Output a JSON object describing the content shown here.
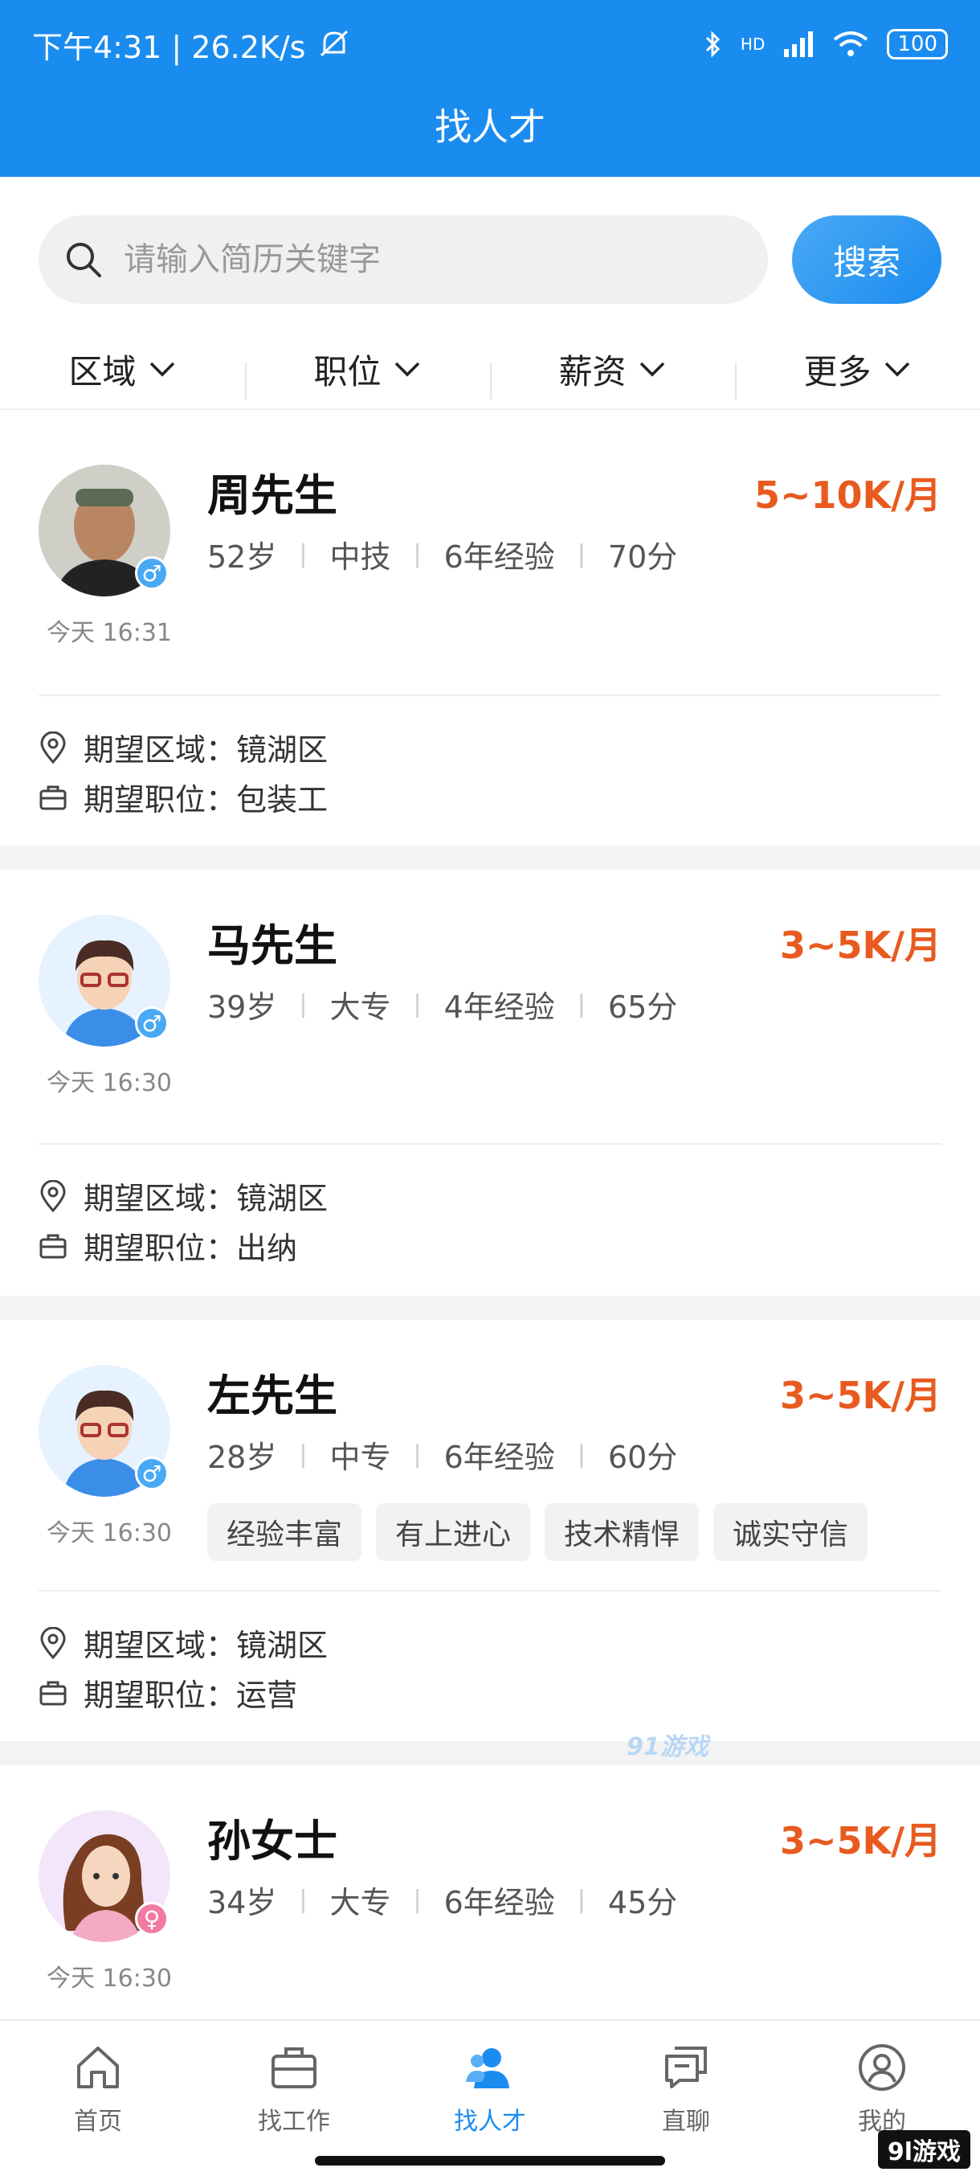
{
  "status_bar": {
    "time_and_speed": "下午4:31 | 26.2K/s",
    "signal": "HD",
    "battery": "100"
  },
  "header": {
    "title": "找人才"
  },
  "search": {
    "placeholder": "请输入简历关键字",
    "value": "",
    "button_label": "搜索"
  },
  "filters": [
    {
      "label": "区域"
    },
    {
      "label": "职位"
    },
    {
      "label": "薪资"
    },
    {
      "label": "更多"
    }
  ],
  "expect_labels": {
    "area": "期望区域：",
    "position": "期望职位："
  },
  "candidates": [
    {
      "name": "周先生",
      "salary": "5~10K/月",
      "age": "52岁",
      "education": "中技",
      "experience": "6年经验",
      "score": "70分",
      "time": "今天 16:31",
      "gender_symbol": "♂",
      "area": "镜湖区",
      "position": "包装工",
      "tags": []
    },
    {
      "name": "马先生",
      "salary": "3~5K/月",
      "age": "39岁",
      "education": "大专",
      "experience": "4年经验",
      "score": "65分",
      "time": "今天 16:30",
      "gender_symbol": "♂",
      "area": "镜湖区",
      "position": "出纳",
      "tags": []
    },
    {
      "name": "左先生",
      "salary": "3~5K/月",
      "age": "28岁",
      "education": "中专",
      "experience": "6年经验",
      "score": "60分",
      "time": "今天 16:30",
      "gender_symbol": "♂",
      "area": "镜湖区",
      "position": "运营",
      "tags": [
        "经验丰富",
        "有上进心",
        "技术精悍",
        "诚实守信"
      ]
    },
    {
      "name": "孙女士",
      "salary": "3~5K/月",
      "age": "34岁",
      "education": "大专",
      "experience": "6年经验",
      "score": "45分",
      "time": "今天 16:30",
      "gender_symbol": "♀",
      "tags": []
    }
  ],
  "bottom_nav": [
    {
      "label": "首页",
      "icon": "home-icon"
    },
    {
      "label": "找工作",
      "icon": "briefcase-icon"
    },
    {
      "label": "找人才",
      "icon": "people-icon",
      "active": true
    },
    {
      "label": "直聊",
      "icon": "chat-icon"
    },
    {
      "label": "我的",
      "icon": "profile-icon"
    }
  ],
  "watermarks": {
    "center": "91游戏",
    "corner": "9l游戏"
  },
  "colors": {
    "brand": "#1a8cf0",
    "salary": "#e85a1f",
    "male_badge": "#4aa9f4",
    "female_badge": "#f07aa0"
  }
}
